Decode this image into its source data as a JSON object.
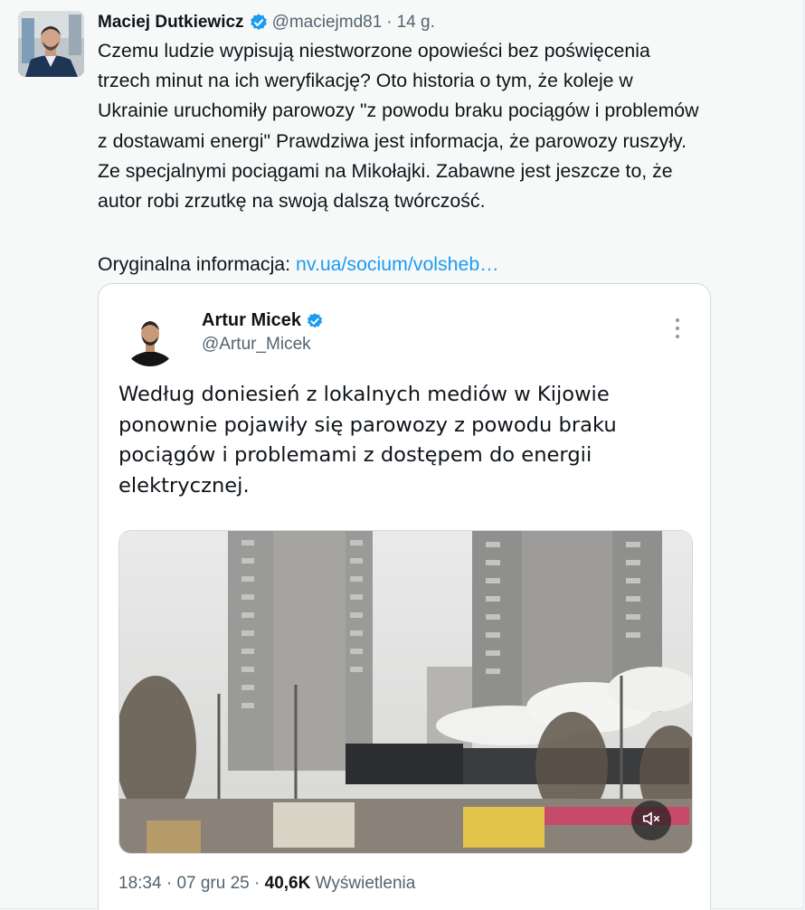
{
  "tweet": {
    "author_name": "Maciej Dutkiewicz",
    "handle": "@maciejmd81",
    "separator": "·",
    "time_ago": "14 g.",
    "text_lines": [
      "Czemu ludzie wypisują niestworzone opowieści bez poświęcenia",
      "trzech minut na ich weryfikację? Oto historia o tym, że koleje w",
      "Ukrainie uruchomiły parowozy \"z powodu braku pociągów i problemów",
      "z dostawami energi\" Prawdziwa jest informacja, że parowozy ruszyły.",
      "Ze specjalnymi pociągami na Mikołajki. Zabawne jest jeszcze to, że",
      "autor robi zrzutkę na swoją dalszą twórczość."
    ],
    "original_label": "Oryginalna informacja:",
    "original_link": "nv.ua/socium/volsheb…"
  },
  "quoted": {
    "author_name": "Artur Micek",
    "handle": "@Artur_Micek",
    "text_lines": [
      "Według doniesień z lokalnych mediów w Kijowie",
      "ponownie pojawiły się parowozy z powodu braku",
      "pociągów i problemami z dostępem do energii",
      "elektrycznej."
    ],
    "media_icon": "mute-icon",
    "time": "18:34",
    "separator": "·",
    "date": "07 gru 25",
    "views_count": "40,6K",
    "views_label": "Wyświetlenia"
  },
  "colors": {
    "link": "#1d9bf0",
    "verified": "#1d9bf0",
    "secondary_text": "#536471",
    "background": "#f7f9f9"
  }
}
